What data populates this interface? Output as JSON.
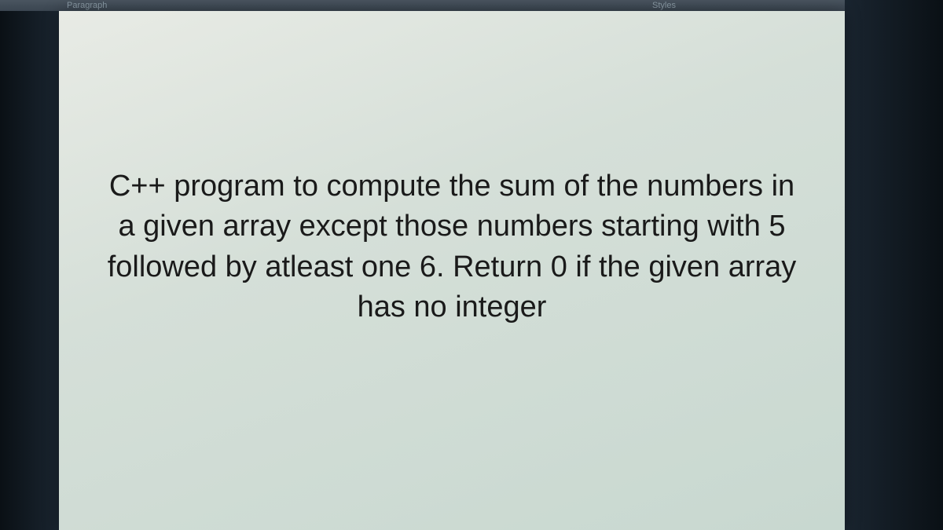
{
  "ribbon": {
    "paragraph_label": "Paragraph",
    "styles_label": "Styles"
  },
  "document": {
    "body_text": "C++ program to compute the sum of the numbers in a given array except those numbers starting with 5 followed by atleast one 6. Return 0 if the given array has no integer"
  }
}
